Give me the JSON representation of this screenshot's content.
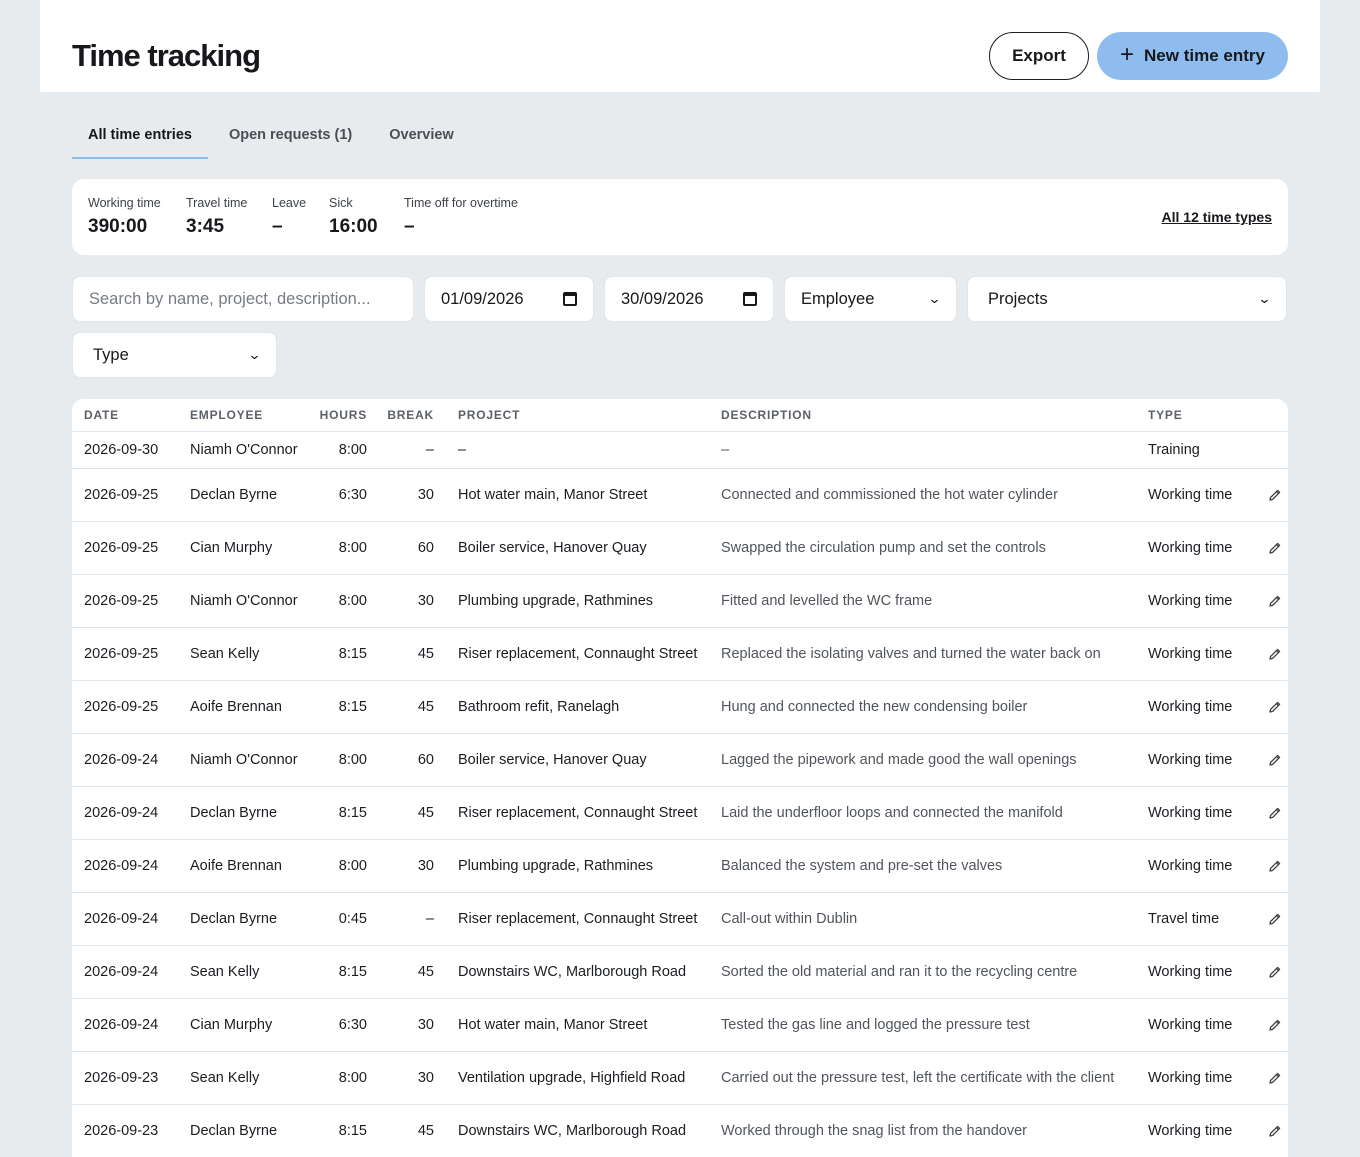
{
  "header": {
    "title": "Time tracking",
    "export_label": "Export",
    "new_entry_label": "New time entry",
    "new_entry_icon": "plus-icon"
  },
  "tabs": [
    {
      "label": "All time entries",
      "active": true
    },
    {
      "label": "Open requests (1)",
      "active": false
    },
    {
      "label": "Overview",
      "active": false
    }
  ],
  "summary": {
    "stats": [
      {
        "label": "Working time",
        "value": "390:00"
      },
      {
        "label": "Travel time",
        "value": "3:45"
      },
      {
        "label": "Leave",
        "value": "–"
      },
      {
        "label": "Sick",
        "value": "16:00"
      },
      {
        "label": "Time off for overtime",
        "value": "–"
      }
    ],
    "all_types_link": "All 12 time types"
  },
  "filters": {
    "search_placeholder": "Search by name, project, description...",
    "date_from": "01/09/2026",
    "date_to": "30/09/2026",
    "employee": "Employee",
    "projects": "Projects",
    "type": "Type"
  },
  "table": {
    "columns": [
      "DATE",
      "EMPLOYEE",
      "HOURS",
      "BREAK",
      "PROJECT",
      "DESCRIPTION",
      "TYPE"
    ],
    "rows": [
      {
        "date": "2026-09-30",
        "employee": "Niamh O'Connor",
        "hours": "8:00",
        "break": "–",
        "project": "–",
        "description": "–",
        "type": "Training",
        "editable": false
      },
      {
        "date": "2026-09-25",
        "employee": "Declan Byrne",
        "hours": "6:30",
        "break": "30",
        "project": "Hot water main, Manor Street",
        "description": "Connected and commissioned the hot water cylinder",
        "type": "Working time",
        "editable": true
      },
      {
        "date": "2026-09-25",
        "employee": "Cian Murphy",
        "hours": "8:00",
        "break": "60",
        "project": "Boiler service, Hanover Quay",
        "description": "Swapped the circulation pump and set the controls",
        "type": "Working time",
        "editable": true
      },
      {
        "date": "2026-09-25",
        "employee": "Niamh O'Connor",
        "hours": "8:00",
        "break": "30",
        "project": "Plumbing upgrade, Rathmines",
        "description": "Fitted and levelled the WC frame",
        "type": "Working time",
        "editable": true
      },
      {
        "date": "2026-09-25",
        "employee": "Sean Kelly",
        "hours": "8:15",
        "break": "45",
        "project": "Riser replacement, Connaught Street",
        "description": "Replaced the isolating valves and turned the water back on",
        "type": "Working time",
        "editable": true
      },
      {
        "date": "2026-09-25",
        "employee": "Aoife Brennan",
        "hours": "8:15",
        "break": "45",
        "project": "Bathroom refit, Ranelagh",
        "description": "Hung and connected the new condensing boiler",
        "type": "Working time",
        "editable": true
      },
      {
        "date": "2026-09-24",
        "employee": "Niamh O'Connor",
        "hours": "8:00",
        "break": "60",
        "project": "Boiler service, Hanover Quay",
        "description": "Lagged the pipework and made good the wall openings",
        "type": "Working time",
        "editable": true
      },
      {
        "date": "2026-09-24",
        "employee": "Declan Byrne",
        "hours": "8:15",
        "break": "45",
        "project": "Riser replacement, Connaught Street",
        "description": "Laid the underfloor loops and connected the manifold",
        "type": "Working time",
        "editable": true
      },
      {
        "date": "2026-09-24",
        "employee": "Aoife Brennan",
        "hours": "8:00",
        "break": "30",
        "project": "Plumbing upgrade, Rathmines",
        "description": "Balanced the system and pre-set the valves",
        "type": "Working time",
        "editable": true
      },
      {
        "date": "2026-09-24",
        "employee": "Declan Byrne",
        "hours": "0:45",
        "break": "–",
        "project": "Riser replacement, Connaught Street",
        "description": "Call-out within Dublin",
        "type": "Travel time",
        "editable": true
      },
      {
        "date": "2026-09-24",
        "employee": "Sean Kelly",
        "hours": "8:15",
        "break": "45",
        "project": "Downstairs WC, Marlborough Road",
        "description": "Sorted the old material and ran it to the recycling centre",
        "type": "Working time",
        "editable": true
      },
      {
        "date": "2026-09-24",
        "employee": "Cian Murphy",
        "hours": "6:30",
        "break": "30",
        "project": "Hot water main, Manor Street",
        "description": "Tested the gas line and logged the pressure test",
        "type": "Working time",
        "editable": true
      },
      {
        "date": "2026-09-23",
        "employee": "Sean Kelly",
        "hours": "8:00",
        "break": "30",
        "project": "Ventilation upgrade, Highfield Road",
        "description": "Carried out the pressure test, left the certificate with the client",
        "type": "Working time",
        "editable": true
      },
      {
        "date": "2026-09-23",
        "employee": "Declan Byrne",
        "hours": "8:15",
        "break": "45",
        "project": "Downstairs WC, Marlborough Road",
        "description": "Worked through the snag list from the handover",
        "type": "Working time",
        "editable": true
      }
    ]
  },
  "colors": {
    "accent": "#8fbcee",
    "page_background": "#e8ebee"
  }
}
